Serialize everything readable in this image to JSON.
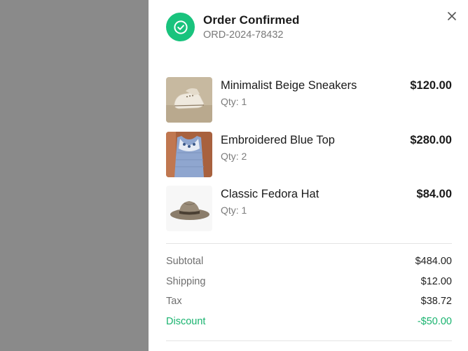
{
  "modal": {
    "title": "Order Confirmed",
    "order_id": "ORD-2024-78432",
    "status_color": "#19c37d",
    "icons": {
      "status": "check-circle-icon",
      "close": "close-icon"
    }
  },
  "items": [
    {
      "name": "Minimalist Beige Sneakers",
      "qty": "Qty: 1",
      "price": "$120.00",
      "image": "beige-sneakers"
    },
    {
      "name": "Embroidered Blue Top",
      "qty": "Qty: 2",
      "price": "$280.00",
      "image": "blue-top"
    },
    {
      "name": "Classic Fedora Hat",
      "qty": "Qty: 1",
      "price": "$84.00",
      "image": "fedora-hat"
    }
  ],
  "summary": {
    "subtotal": {
      "label": "Subtotal",
      "value": "$484.00"
    },
    "shipping": {
      "label": "Shipping",
      "value": "$12.00"
    },
    "tax": {
      "label": "Tax",
      "value": "$38.72"
    },
    "discount": {
      "label": "Discount",
      "value": "-$50.00",
      "color": "#19b36f"
    }
  }
}
